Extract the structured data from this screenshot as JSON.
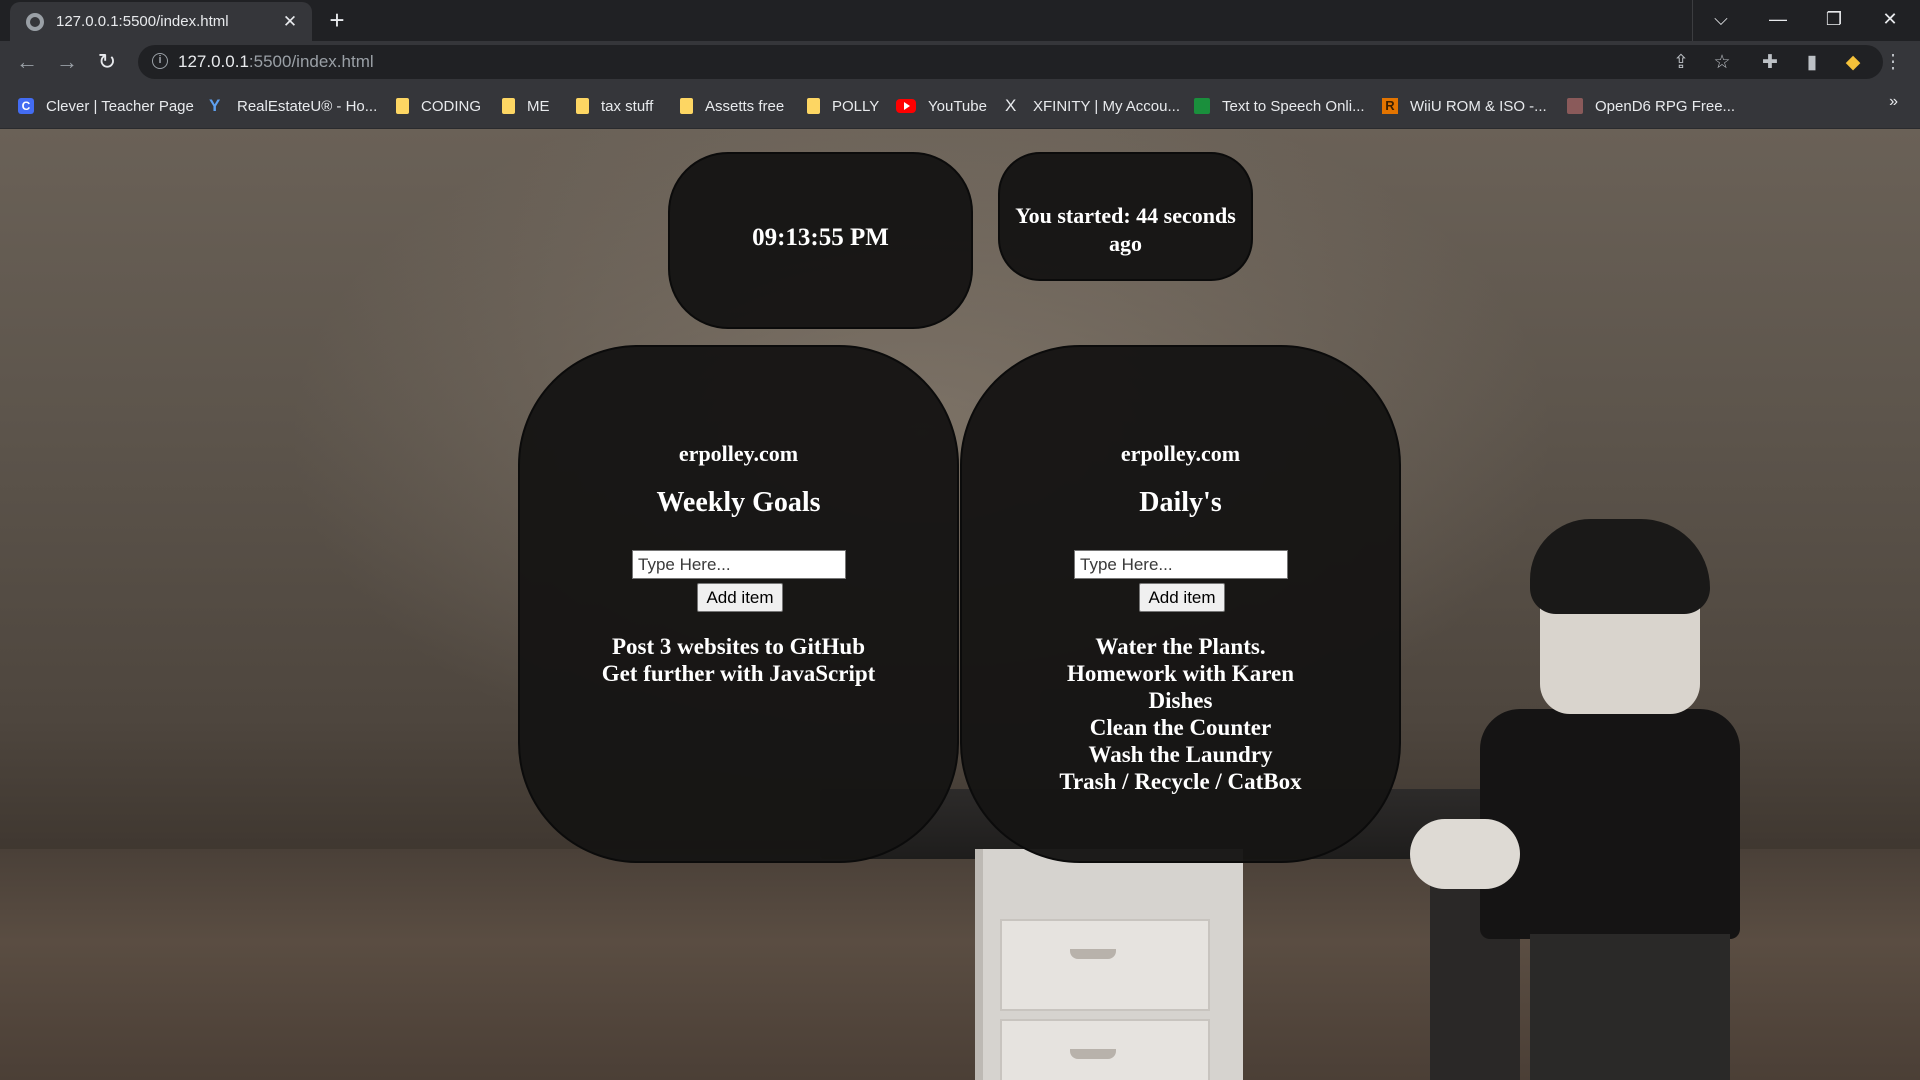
{
  "browser": {
    "tab_title": "127.0.0.1:5500/index.html",
    "tab_close": "✕",
    "new_tab": "+",
    "url_host": "127.0.0.1",
    "url_path": ":5500/index.html",
    "window_controls": {
      "collapse": "⌵",
      "minimize": "—",
      "restore": "❐",
      "close": "✕"
    },
    "nav": {
      "back": "←",
      "forward": "→",
      "reload": "↻"
    },
    "toolbar_icons": [
      "share-icon",
      "star-icon",
      "extensions-icon",
      "side-panel-icon",
      "profile-icon",
      "menu-icon"
    ]
  },
  "bookmarks": {
    "items": [
      {
        "label": "Clever | Teacher Page",
        "icon": "clever-icon"
      },
      {
        "label": "RealEstateU® - Ho...",
        "icon": "realestateu-icon"
      },
      {
        "label": "CODING",
        "icon": "folder-icon"
      },
      {
        "label": "ME",
        "icon": "folder-icon"
      },
      {
        "label": "tax stuff",
        "icon": "folder-icon"
      },
      {
        "label": "Assetts free",
        "icon": "folder-icon"
      },
      {
        "label": "POLLY",
        "icon": "folder-icon"
      },
      {
        "label": "YouTube",
        "icon": "youtube-icon"
      },
      {
        "label": "XFINITY | My Accou...",
        "icon": "xfinity-icon"
      },
      {
        "label": "Text to Speech Onli...",
        "icon": "tts-icon"
      },
      {
        "label": "WiiU ROM & ISO -...",
        "icon": "romsfun-icon"
      },
      {
        "label": "OpenD6 RPG Free...",
        "icon": "opend6-icon"
      }
    ],
    "more": "»"
  },
  "clock": {
    "time": "09:13:55 PM"
  },
  "started": {
    "text": "You started: 44 seconds ago"
  },
  "weekly": {
    "site": "erpolley.com",
    "heading": "Weekly Goals",
    "input_placeholder": "Type Here...",
    "button_label": "Add item",
    "items": [
      "Post 3 websites to GitHub",
      "Get further with JavaScript"
    ]
  },
  "daily": {
    "site": "erpolley.com",
    "heading": "Daily's",
    "input_placeholder": "Type Here...",
    "button_label": "Add item",
    "items": [
      "Water the Plants.",
      "Homework with Karen",
      "Dishes",
      "Clean the Counter",
      "Wash the Laundry",
      "Trash / Recycle / CatBox"
    ]
  }
}
